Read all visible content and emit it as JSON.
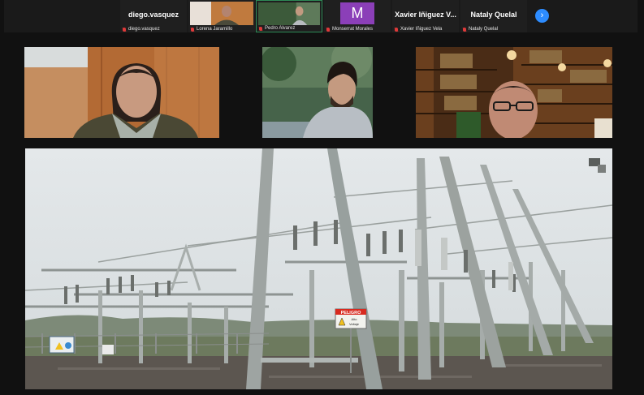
{
  "strip": {
    "participants": [
      {
        "big_name": "diego.vasquez",
        "small_name": "diego.vasquez"
      },
      {
        "big_name": "",
        "small_name": "Lorena Jaramillo"
      },
      {
        "big_name": "",
        "small_name": "Pedro Alvarez"
      },
      {
        "big_name": "",
        "small_name": "Monserrat Morales",
        "avatar_letter": "M"
      },
      {
        "big_name": "Xavier Iñiguez V...",
        "small_name": "Xavier Iñiguez Vela"
      },
      {
        "big_name": "Nataly Quelal",
        "small_name": "Nataly Quelal"
      }
    ],
    "next_label": "›"
  },
  "sign": {
    "line1": "PELIGRO",
    "line2": "Alto",
    "line3": "Voltaje"
  },
  "colors": {
    "active_border": "#2e8b57",
    "avatar_purple": "#8b3fb8",
    "next_blue": "#2d8cff",
    "mic_red": "#e03a3a"
  }
}
